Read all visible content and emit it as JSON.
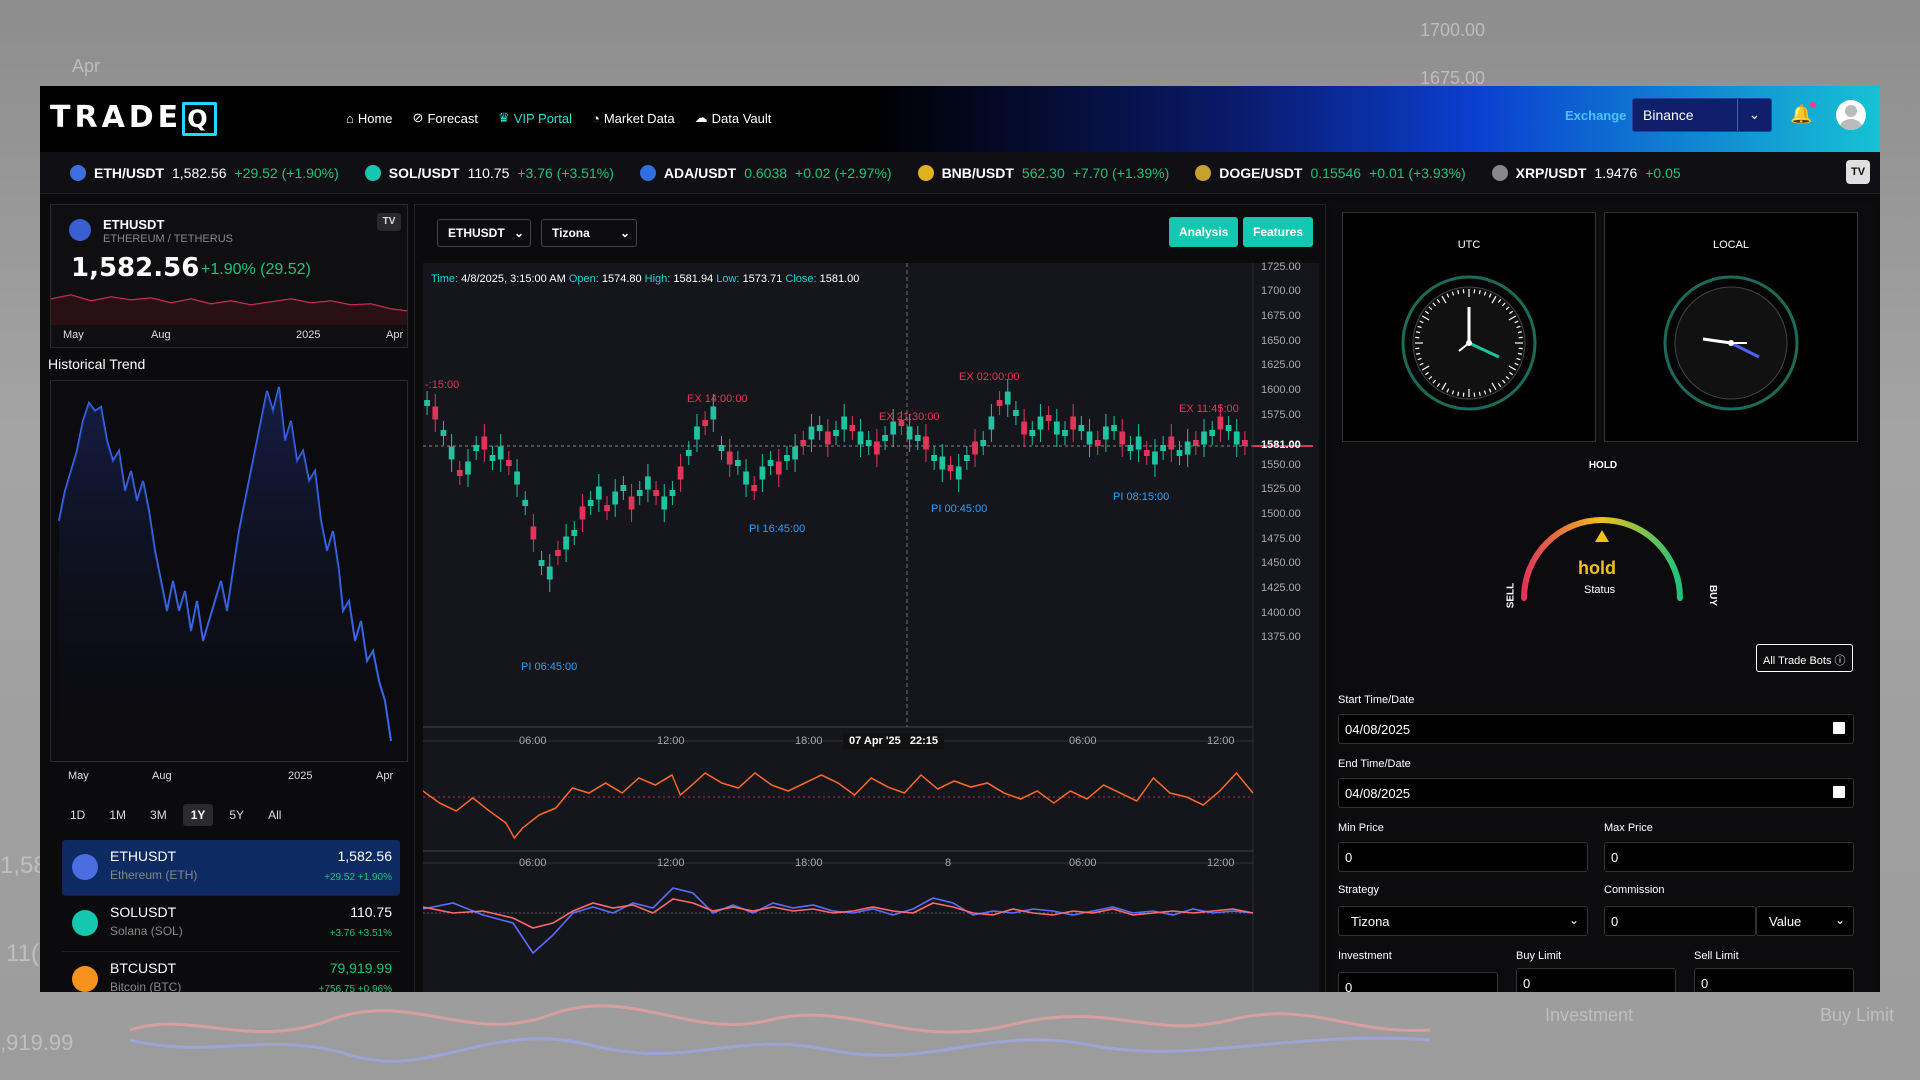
{
  "backdrop": {
    "price1": "1700.00",
    "price2": "1675.00",
    "apr": "Apr",
    "left1": "1,58",
    "left2": "11(",
    "left3": ",919.99",
    "investment": "Investment",
    "buy_limit": "Buy Limit"
  },
  "nav": {
    "logo": "TRADE",
    "logo_q": "Q",
    "items": [
      "Home",
      "Forecast",
      "VIP Portal",
      "Market Data",
      "Data Vault"
    ],
    "exchange_label": "Exchange",
    "exchange_value": "Binance"
  },
  "ticker": [
    {
      "sym": "ETH/USDT",
      "price": "1,582.56",
      "change": "+29.52 (+1.90%)",
      "color": "#3d6ee0",
      "green": false
    },
    {
      "sym": "SOL/USDT",
      "price": "110.75",
      "change": "+3.76 (+3.51%)",
      "color": "#14c7b0",
      "green": false
    },
    {
      "sym": "ADA/USDT",
      "price": "0.6038",
      "change": "+0.02 (+2.97%)",
      "color": "#2f6fe0",
      "green": true
    },
    {
      "sym": "BNB/USDT",
      "price": "562.30",
      "change": "+7.70 (+1.39%)",
      "color": "#e0b020",
      "green": true
    },
    {
      "sym": "DOGE/USDT",
      "price": "0.15546",
      "change": "+0.01 (+3.93%)",
      "color": "#c8a030",
      "green": true
    },
    {
      "sym": "XRP/USDT",
      "price": "1.9476",
      "change": "+0.05",
      "color": "#888888",
      "green": false
    }
  ],
  "mini": {
    "symbol": "ETHUSDT",
    "name": "ETHEREUM / TETHERUS",
    "price": "1,582.56",
    "change": "+1.90% (29.52)",
    "axis": [
      "May",
      "Aug",
      "2025",
      "Apr"
    ]
  },
  "historical": {
    "title": "Historical Trend",
    "axis": [
      "May",
      "Aug",
      "2025",
      "Apr"
    ],
    "ranges": [
      "1D",
      "1M",
      "3M",
      "1Y",
      "5Y",
      "All"
    ],
    "active_range": "1Y"
  },
  "watchlist": [
    {
      "sym": "ETHUSDT",
      "name": "Ethereum (ETH)",
      "price": "1,582.56",
      "change": "+29.52  +1.90%",
      "color": "#4a6de0",
      "active": true
    },
    {
      "sym": "SOLUSDT",
      "name": "Solana (SOL)",
      "price": "110.75",
      "change": "+3.76  +3.51%",
      "color": "#14c7b0",
      "active": false
    },
    {
      "sym": "BTCUSDT",
      "name": "Bitcoin (BTC)",
      "price": "79,919.99",
      "change": "+756.75  +0.96%",
      "color": "#f7931a",
      "active": false
    }
  ],
  "chart": {
    "symbol_select": "ETHUSDT",
    "strategy_select": "Tizona",
    "analysis_btn": "Analysis",
    "features_btn": "Features",
    "info": {
      "time_label": "Time:",
      "time": "4/8/2025, 3:15:00 AM",
      "open_label": "Open:",
      "open": "1574.80",
      "high_label": "High:",
      "high": "1581.94",
      "low_label": "Low:",
      "low": "1573.71",
      "close_label": "Close:",
      "close": "1581.00"
    },
    "yticks": [
      "1725.00",
      "1700.00",
      "1675.00",
      "1650.00",
      "1625.00",
      "1600.00",
      "1575.00",
      "1550.00",
      "1525.00",
      "1500.00",
      "1475.00",
      "1450.00",
      "1425.00",
      "1400.00",
      "1375.00"
    ],
    "last_price": "1581.00",
    "xticks": [
      "06:00",
      "12:00",
      "18:00",
      "06:00",
      "12:00"
    ],
    "crosshair_date": "07 Apr '25",
    "crosshair_time": "22:15",
    "markers": [
      {
        "label": "-:15:00",
        "kind": "ex"
      },
      {
        "label": "EX 14:00:00",
        "kind": "ex"
      },
      {
        "label": "EX 21:30:00",
        "kind": "ex"
      },
      {
        "label": "EX 02:00:00",
        "kind": "ex"
      },
      {
        "label": "EX 11:45:00",
        "kind": "ex"
      },
      {
        "label": "PI 06:45:00",
        "kind": "pi"
      },
      {
        "label": "PI 16:45:00",
        "kind": "pi"
      },
      {
        "label": "PI 00:45:00",
        "kind": "pi"
      },
      {
        "label": "PI 08:15:00",
        "kind": "pi"
      }
    ],
    "sub_xticks": [
      "06:00",
      "12:00",
      "18:00",
      "8",
      "06:00",
      "12:00"
    ]
  },
  "right": {
    "utc": "UTC",
    "local": "LOCAL",
    "hold_title": "HOLD",
    "gauge_value": "hold",
    "gauge_status": "Status",
    "sell": "SELL",
    "buy": "BUY",
    "all_bots": "All Trade Bots",
    "start_label": "Start Time/Date",
    "start_value": "04/08/2025",
    "end_label": "End Time/Date",
    "end_value": "04/08/2025",
    "min_label": "Min Price",
    "min_value": "0",
    "max_label": "Max Price",
    "max_value": "0",
    "strategy_label": "Strategy",
    "strategy_value": "Tizona",
    "commission_label": "Commission",
    "commission_value": "0",
    "commission_type": "Value",
    "investment_label": "Investment",
    "investment_value": "0",
    "buy_limit_label": "Buy Limit",
    "buy_limit_value": "0",
    "sell_limit_label": "Sell Limit",
    "sell_limit_value": "0"
  },
  "colors": {
    "green": "#1ec37a",
    "red": "#e0355a",
    "teal": "#14c7b0",
    "blue": "#3a6df0",
    "orange": "#ff6a2a"
  }
}
